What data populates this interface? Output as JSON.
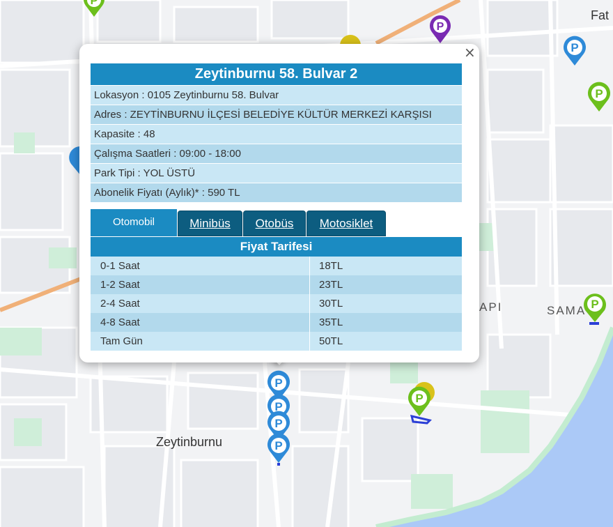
{
  "map": {
    "labels": {
      "zeytinburnu": "Zeytinburnu",
      "samatya": "SAMA  A",
      "kapi": "API",
      "fatih": "Fat"
    },
    "colors": {
      "land": "#f2f3f5",
      "block": "#e6e8ec",
      "road": "#ffffff",
      "park": "#c8ead2",
      "water": "#aac8f6",
      "highway": "#f2b37a",
      "marker_blue": "#2e8ad8",
      "marker_green": "#6cbf1c",
      "marker_yellow": "#d9c21a",
      "marker_purple": "#7a2bb3"
    }
  },
  "popup": {
    "close_symbol": "×",
    "title": "Zeytinburnu 58. Bulvar 2",
    "info": [
      "Lokasyon : 0105 Zeytinburnu 58. Bulvar",
      "Adres : ZEYTİNBURNU İLÇESİ BELEDİYE KÜLTÜR MERKEZİ KARŞISI",
      "Kapasite : 48",
      "Çalışma Saatleri : 09:00 - 18:00",
      "Park Tipi : YOL ÜSTÜ",
      "Abonelik Fiyatı (Aylık)* : 590 TL"
    ],
    "tabs": [
      "Otomobil",
      "Minibüs",
      "Otobüs",
      "Motosiklet"
    ],
    "active_tab": "Otomobil",
    "tariff_title": "Fiyat Tarifesi",
    "tariff": [
      {
        "duration": "0-1 Saat",
        "price": "18TL"
      },
      {
        "duration": "1-2 Saat",
        "price": "23TL"
      },
      {
        "duration": "2-4 Saat",
        "price": "30TL"
      },
      {
        "duration": "4-8 Saat",
        "price": "35TL"
      },
      {
        "duration": "Tam Gün",
        "price": "50TL"
      }
    ]
  }
}
